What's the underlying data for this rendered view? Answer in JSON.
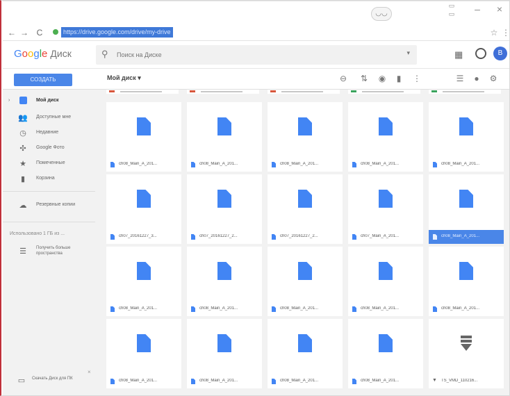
{
  "browser": {
    "url": "https://drive.google.com/drive/my-drive",
    "back": "←",
    "forward": "→",
    "reload": "C"
  },
  "app": {
    "logo_letters": [
      "G",
      "o",
      "o",
      "g",
      "l",
      "e"
    ],
    "product": "Диск",
    "search_placeholder": "Поиск на Диске",
    "avatar_letter": "B"
  },
  "toolbar": {
    "create_label": "СОЗДАТЬ",
    "breadcrumb": "Мой диск ▾"
  },
  "sidebar": {
    "items": [
      {
        "label": "Мой диск",
        "icon": "drive-icon"
      },
      {
        "label": "Доступные мне",
        "icon": "shared-icon"
      },
      {
        "label": "Недавние",
        "icon": "clock-icon"
      },
      {
        "label": "Google Фото",
        "icon": "photos-icon"
      },
      {
        "label": "Помеченные",
        "icon": "star-icon"
      },
      {
        "label": "Корзина",
        "icon": "trash-icon"
      }
    ],
    "backups": {
      "label": "Резервные копии",
      "icon": "cloud-icon"
    },
    "storage": "Использовано 1 ГБ из ...",
    "get_more": "Получить больше пространства",
    "download": "Скачать Диск для ПК"
  },
  "files": [
    [
      "ch08_Main_A_201...",
      "ch08_Main_A_201...",
      "ch08_Main_A_201...",
      "ch08_Main_A_201...",
      "ch08_Main_A_201..."
    ],
    [
      "ch07_20161227_3...",
      "ch07_20161227_2...",
      "ch07_20161227_2...",
      "ch07_Main_A_201...",
      "ch08_Main_A_201..."
    ],
    [
      "ch08_Main_A_201...",
      "ch08_Main_A_201...",
      "ch08_Main_A_201...",
      "ch08_Main_A_201...",
      "ch08_Main_A_201..."
    ],
    [
      "ch08_Main_A_201...",
      "ch08_Main_A_201...",
      "ch08_Main_A_201...",
      "ch08_Main_A_201...",
      "TS_VMD_110216..."
    ]
  ],
  "selected_file": {
    "row": 1,
    "col": 4
  },
  "colors": {
    "accent": "#4a86e8",
    "doc_blue": "#4285f4",
    "sidebar_bg": "#f2f2f2"
  }
}
